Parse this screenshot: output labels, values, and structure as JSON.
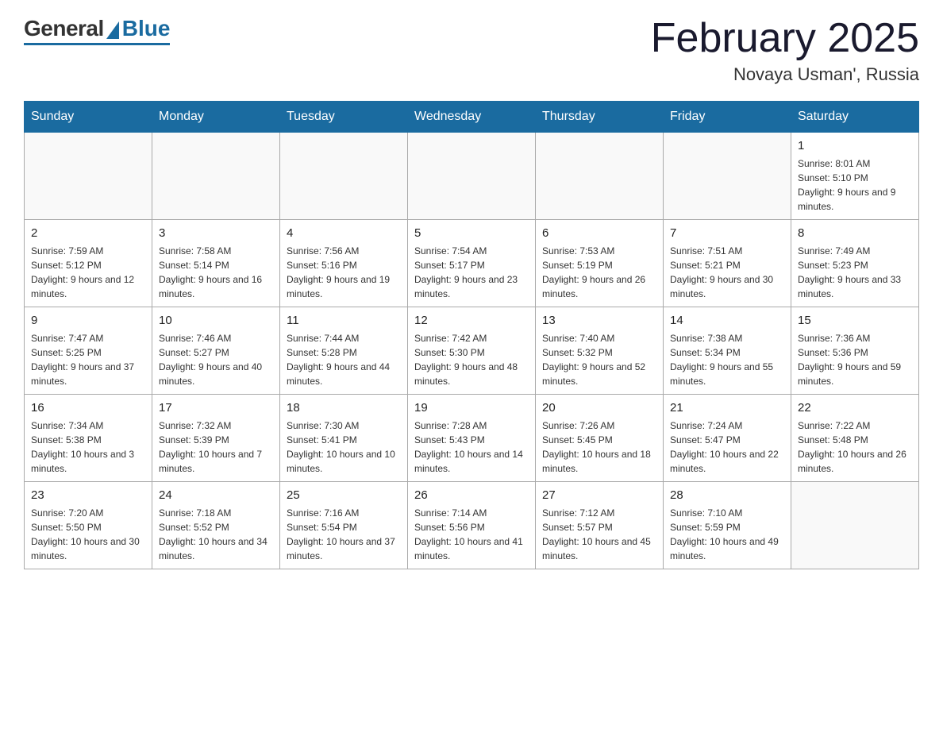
{
  "logo": {
    "general": "General",
    "blue": "Blue",
    "underline": "Blue"
  },
  "title": "February 2025",
  "location": "Novaya Usman', Russia",
  "days_of_week": [
    "Sunday",
    "Monday",
    "Tuesday",
    "Wednesday",
    "Thursday",
    "Friday",
    "Saturday"
  ],
  "weeks": [
    [
      {
        "day": "",
        "info": ""
      },
      {
        "day": "",
        "info": ""
      },
      {
        "day": "",
        "info": ""
      },
      {
        "day": "",
        "info": ""
      },
      {
        "day": "",
        "info": ""
      },
      {
        "day": "",
        "info": ""
      },
      {
        "day": "1",
        "info": "Sunrise: 8:01 AM\nSunset: 5:10 PM\nDaylight: 9 hours and 9 minutes."
      }
    ],
    [
      {
        "day": "2",
        "info": "Sunrise: 7:59 AM\nSunset: 5:12 PM\nDaylight: 9 hours and 12 minutes."
      },
      {
        "day": "3",
        "info": "Sunrise: 7:58 AM\nSunset: 5:14 PM\nDaylight: 9 hours and 16 minutes."
      },
      {
        "day": "4",
        "info": "Sunrise: 7:56 AM\nSunset: 5:16 PM\nDaylight: 9 hours and 19 minutes."
      },
      {
        "day": "5",
        "info": "Sunrise: 7:54 AM\nSunset: 5:17 PM\nDaylight: 9 hours and 23 minutes."
      },
      {
        "day": "6",
        "info": "Sunrise: 7:53 AM\nSunset: 5:19 PM\nDaylight: 9 hours and 26 minutes."
      },
      {
        "day": "7",
        "info": "Sunrise: 7:51 AM\nSunset: 5:21 PM\nDaylight: 9 hours and 30 minutes."
      },
      {
        "day": "8",
        "info": "Sunrise: 7:49 AM\nSunset: 5:23 PM\nDaylight: 9 hours and 33 minutes."
      }
    ],
    [
      {
        "day": "9",
        "info": "Sunrise: 7:47 AM\nSunset: 5:25 PM\nDaylight: 9 hours and 37 minutes."
      },
      {
        "day": "10",
        "info": "Sunrise: 7:46 AM\nSunset: 5:27 PM\nDaylight: 9 hours and 40 minutes."
      },
      {
        "day": "11",
        "info": "Sunrise: 7:44 AM\nSunset: 5:28 PM\nDaylight: 9 hours and 44 minutes."
      },
      {
        "day": "12",
        "info": "Sunrise: 7:42 AM\nSunset: 5:30 PM\nDaylight: 9 hours and 48 minutes."
      },
      {
        "day": "13",
        "info": "Sunrise: 7:40 AM\nSunset: 5:32 PM\nDaylight: 9 hours and 52 minutes."
      },
      {
        "day": "14",
        "info": "Sunrise: 7:38 AM\nSunset: 5:34 PM\nDaylight: 9 hours and 55 minutes."
      },
      {
        "day": "15",
        "info": "Sunrise: 7:36 AM\nSunset: 5:36 PM\nDaylight: 9 hours and 59 minutes."
      }
    ],
    [
      {
        "day": "16",
        "info": "Sunrise: 7:34 AM\nSunset: 5:38 PM\nDaylight: 10 hours and 3 minutes."
      },
      {
        "day": "17",
        "info": "Sunrise: 7:32 AM\nSunset: 5:39 PM\nDaylight: 10 hours and 7 minutes."
      },
      {
        "day": "18",
        "info": "Sunrise: 7:30 AM\nSunset: 5:41 PM\nDaylight: 10 hours and 10 minutes."
      },
      {
        "day": "19",
        "info": "Sunrise: 7:28 AM\nSunset: 5:43 PM\nDaylight: 10 hours and 14 minutes."
      },
      {
        "day": "20",
        "info": "Sunrise: 7:26 AM\nSunset: 5:45 PM\nDaylight: 10 hours and 18 minutes."
      },
      {
        "day": "21",
        "info": "Sunrise: 7:24 AM\nSunset: 5:47 PM\nDaylight: 10 hours and 22 minutes."
      },
      {
        "day": "22",
        "info": "Sunrise: 7:22 AM\nSunset: 5:48 PM\nDaylight: 10 hours and 26 minutes."
      }
    ],
    [
      {
        "day": "23",
        "info": "Sunrise: 7:20 AM\nSunset: 5:50 PM\nDaylight: 10 hours and 30 minutes."
      },
      {
        "day": "24",
        "info": "Sunrise: 7:18 AM\nSunset: 5:52 PM\nDaylight: 10 hours and 34 minutes."
      },
      {
        "day": "25",
        "info": "Sunrise: 7:16 AM\nSunset: 5:54 PM\nDaylight: 10 hours and 37 minutes."
      },
      {
        "day": "26",
        "info": "Sunrise: 7:14 AM\nSunset: 5:56 PM\nDaylight: 10 hours and 41 minutes."
      },
      {
        "day": "27",
        "info": "Sunrise: 7:12 AM\nSunset: 5:57 PM\nDaylight: 10 hours and 45 minutes."
      },
      {
        "day": "28",
        "info": "Sunrise: 7:10 AM\nSunset: 5:59 PM\nDaylight: 10 hours and 49 minutes."
      },
      {
        "day": "",
        "info": ""
      }
    ]
  ]
}
